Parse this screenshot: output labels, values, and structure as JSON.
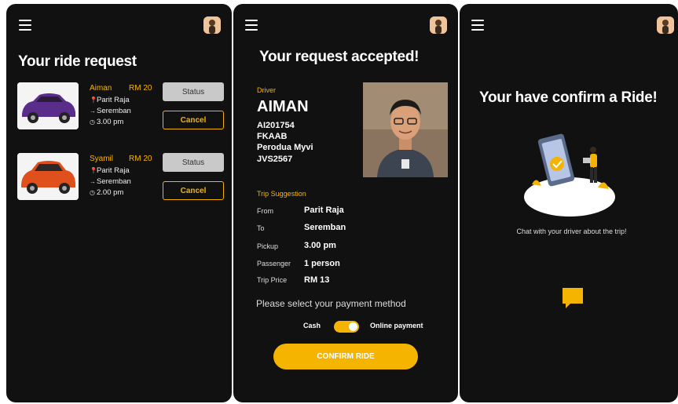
{
  "colors": {
    "accent": "#f5b400",
    "panel_bg": "#111111",
    "status_btn": "#c9c9c9"
  },
  "panel1": {
    "title": "Your ride request",
    "rides": [
      {
        "name": "Aiman",
        "price": "RM 20",
        "from": "Parit Raja",
        "to": "Seremban",
        "time": "3.00 pm",
        "status_label": "Status",
        "cancel_label": "Cancel",
        "car_color": "purple"
      },
      {
        "name": "Syamil",
        "price": "RM 20",
        "from": "Parit Raja",
        "to": "Seremban",
        "time": "2.00 pm",
        "status_label": "Status",
        "cancel_label": "Cancel",
        "car_color": "orange"
      }
    ]
  },
  "panel2": {
    "title": "Your request accepted!",
    "driver_label": "Driver",
    "driver_name": "AIMAN",
    "driver_id": "AI201754",
    "faculty": "FKAAB",
    "car_model": "Perodua Myvi",
    "plate": "JVS2567",
    "trip_label": "Trip Suggestion",
    "trip": [
      {
        "key": "From",
        "value": "Parit Raja"
      },
      {
        "key": "To",
        "value": "Seremban"
      },
      {
        "key": "Pickup",
        "value": "3.00 pm"
      },
      {
        "key": "Passenger",
        "value": "1 person"
      },
      {
        "key": "Trip Price",
        "value": "RM 13"
      }
    ],
    "payment_question": "Please select your payment method",
    "option_cash": "Cash",
    "option_online": "Online payment",
    "toggle_state": "online",
    "confirm_label": "CONFIRM RIDE"
  },
  "panel3": {
    "title": "Your have confirm a Ride!",
    "chat_text": "Chat with your driver about the trip!"
  }
}
